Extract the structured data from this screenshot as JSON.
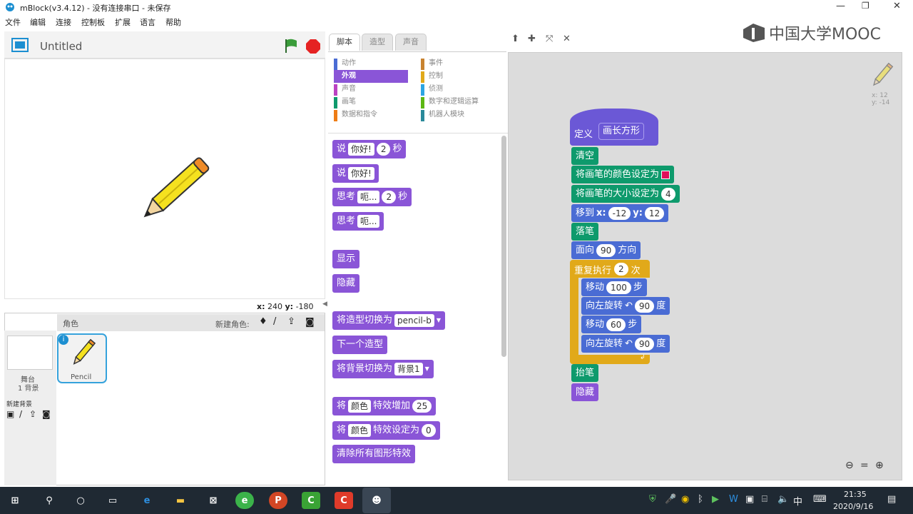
{
  "window": {
    "title": "mBlock(v3.4.12) - 没有连接串口 - 未保存"
  },
  "menu": [
    "文件",
    "编辑",
    "连接",
    "控制板",
    "扩展",
    "语言",
    "帮助"
  ],
  "stage": {
    "title": "Untitled",
    "coords": {
      "x_label": "x:",
      "x": "240",
      "y_label": "y:",
      "y": "-180"
    }
  },
  "sprites": {
    "header": "角色",
    "new_sprite": "新建角色:",
    "stage_label": "舞台",
    "backdrop_count": "1 背景",
    "new_backdrop": "新建背景",
    "sprite_name": "Pencil"
  },
  "tabs": [
    {
      "label": "脚本"
    },
    {
      "label": "造型"
    },
    {
      "label": "声音"
    }
  ],
  "categories_left": [
    {
      "label": "动作",
      "color": "#4a6cd4"
    },
    {
      "label": "外观",
      "color": "#8a55d7",
      "active": true
    },
    {
      "label": "声音",
      "color": "#bb42c3"
    },
    {
      "label": "画笔",
      "color": "#0e9a6c"
    },
    {
      "label": "数据和指令",
      "color": "#ee7d16"
    }
  ],
  "categories_right": [
    {
      "label": "事件",
      "color": "#c88330"
    },
    {
      "label": "控制",
      "color": "#e1a91a"
    },
    {
      "label": "侦测",
      "color": "#2ca5e2"
    },
    {
      "label": "数字和逻辑运算",
      "color": "#5cb712"
    },
    {
      "label": "机器人模块",
      "color": "#2a8a9a"
    }
  ],
  "palette": {
    "say_secs": {
      "say": "说",
      "msg": "你好!",
      "secs": "2",
      "unit": "秒"
    },
    "say": {
      "say": "说",
      "msg": "你好!"
    },
    "think_secs": {
      "think": "思考",
      "msg": "呃...",
      "secs": "2",
      "unit": "秒"
    },
    "think": {
      "think": "思考",
      "msg": "呃..."
    },
    "show": "显示",
    "hide": "隐藏",
    "switch_costume": {
      "label": "将造型切换为",
      "value": "pencil-b"
    },
    "next_costume": "下一个造型",
    "switch_backdrop": {
      "label": "将背景切换为",
      "value": "背景1"
    },
    "change_effect": {
      "prefix": "将",
      "effect": "颜色",
      "label": "特效增加",
      "value": "25"
    },
    "set_effect": {
      "prefix": "将",
      "effect": "颜色",
      "label": "特效设定为",
      "value": "0"
    },
    "clear_effects": "清除所有图形特效"
  },
  "sprite_pos": {
    "x_label": "x:",
    "x": "12",
    "y_label": "y:",
    "y": "-14"
  },
  "script": {
    "define": {
      "label": "定义",
      "name": "画长方形"
    },
    "clear": "清空",
    "set_color": "将画笔的颜色设定为",
    "set_color_value": "#e0105a",
    "set_size": {
      "label": "将画笔的大小设定为",
      "value": "4"
    },
    "goto": {
      "label": "移到",
      "x_label": "x:",
      "x": "-12",
      "y_label": "y:",
      "y": "12"
    },
    "pen_down": "落笔",
    "point": {
      "label": "面向",
      "value": "90",
      "unit": "方向"
    },
    "repeat": {
      "label": "重复执行",
      "value": "2",
      "unit": "次"
    },
    "move1": {
      "label": "移动",
      "value": "100",
      "unit": "步"
    },
    "turn1": {
      "label": "向左旋转",
      "value": "90",
      "unit": "度"
    },
    "move2": {
      "label": "移动",
      "value": "60",
      "unit": "步"
    },
    "turn2": {
      "label": "向左旋转",
      "value": "90",
      "unit": "度"
    },
    "pen_up": "抬笔",
    "hide": "隐藏"
  },
  "watermark": "中国大学MOOC",
  "taskbar": {
    "time": "21:35",
    "date": "2020/9/16",
    "ime": "中"
  }
}
